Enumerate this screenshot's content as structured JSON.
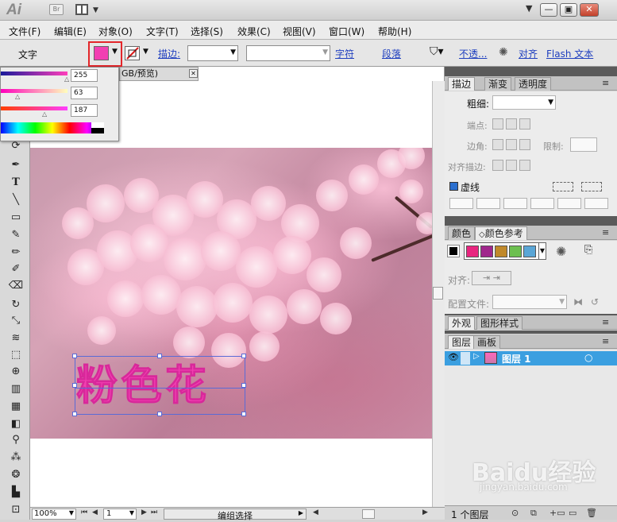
{
  "app": {
    "logo": "Ai",
    "bridge_badge": "Br"
  },
  "menubar": [
    "文件(F)",
    "编辑(E)",
    "对象(O)",
    "文字(T)",
    "选择(S)",
    "效果(C)",
    "视图(V)",
    "窗口(W)",
    "帮助(H)"
  ],
  "control": {
    "mode_label": "文字",
    "fill_color": "#f23fb2",
    "stroke_label": "描边:",
    "char_link": "字符",
    "para_link": "段落",
    "opacity_link": "不透...",
    "align_link": "对齐",
    "flash_link": "Flash 文本"
  },
  "document": {
    "tab_title": "GB/预览)"
  },
  "color_flyout": {
    "r": "255",
    "g": "63",
    "b": "187"
  },
  "canvas": {
    "art_text": "粉色花"
  },
  "stroke_panel": {
    "tabs": [
      "描边",
      "渐变",
      "透明度"
    ],
    "weight_label": "粗细:",
    "cap_label": "端点:",
    "corner_label": "边角:",
    "limit_label": "限制:",
    "align_label": "对齐描边:",
    "dashed_label": "虚线"
  },
  "color_panel": {
    "tabs": [
      "颜色",
      "颜色参考"
    ],
    "swatches": [
      "#e8257f",
      "#a0278c",
      "#c0892a",
      "#6cbf4f",
      "#5aa6d6"
    ]
  },
  "align_panel": {
    "align_label": "对齐:",
    "profile_label": "配置文件:"
  },
  "appearance_panel": {
    "tabs": [
      "外观",
      "图形样式"
    ]
  },
  "layers_panel": {
    "tabs": [
      "图层",
      "画板"
    ],
    "layer_name": "图层 1",
    "footer": "1 个图层"
  },
  "statusbar": {
    "zoom": "100%",
    "page": "1",
    "tool_status": "编组选择"
  },
  "watermark": {
    "brand": "Baidu经验",
    "url": "jingyan.baidu.com"
  }
}
